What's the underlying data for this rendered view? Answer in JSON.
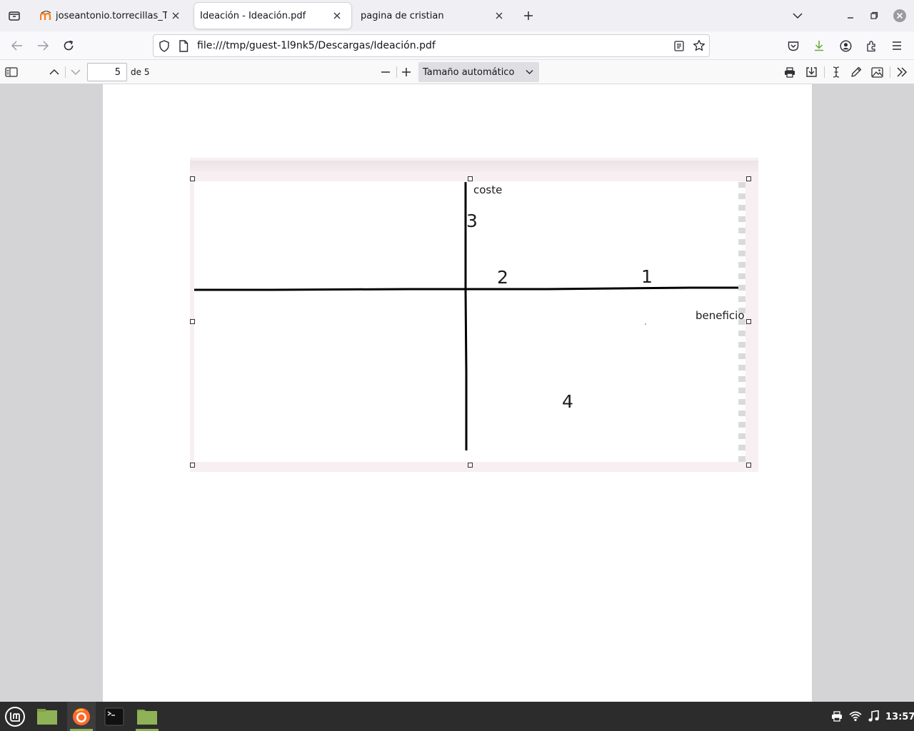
{
  "tabs": [
    {
      "label": "joseantonio.torrecillas_TD_",
      "icon": "moodle-icon",
      "active": false
    },
    {
      "label": "Ideación - Ideación.pdf",
      "icon": "none",
      "active": true
    },
    {
      "label": "pagina de cristian",
      "icon": "none",
      "active": false
    }
  ],
  "navbar": {
    "url": "file:///tmp/guest-1l9nk5/Descargas/Ideación.pdf"
  },
  "pdf_toolbar": {
    "page_number": "5",
    "page_of": "de 5",
    "zoom": "Tamaño automático"
  },
  "figure": {
    "label_y_axis": "coste",
    "label_x_axis": "beneficio",
    "marker_1": "1",
    "marker_2": "2",
    "marker_3": "3",
    "marker_4": "4"
  },
  "taskbar": {
    "clock": "13:57"
  },
  "colors": {
    "accent_download": "#6aa637",
    "taskbar_underline": "#8fb256",
    "firefox_orange": "#ff6a2b"
  }
}
